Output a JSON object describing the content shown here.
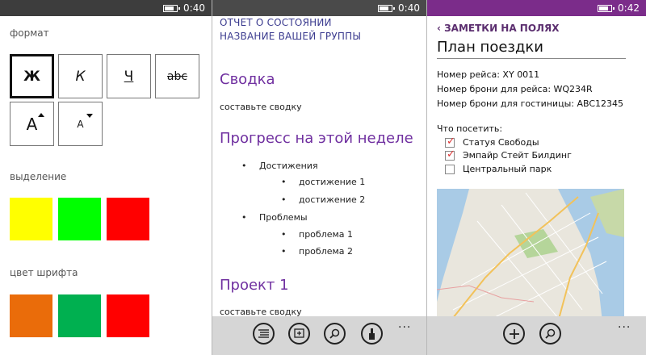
{
  "status": {
    "time1": "0:40",
    "time2": "0:40",
    "time3": "0:42"
  },
  "format_panel": {
    "format_label": "формат",
    "buttons": {
      "bold": "Ж",
      "italic": "К",
      "underline": "Ч",
      "strike": "abc",
      "grow": "A",
      "shrink": "A"
    },
    "highlight_label": "выделение",
    "highlight_colors": [
      "#ffff00",
      "#00ff00",
      "#ff0000"
    ],
    "fontcolor_label": "цвет шрифта",
    "font_colors": [
      "#ea6c0a",
      "#00b050",
      "#ff0000"
    ]
  },
  "report": {
    "header_line1": "ОТЧЕТ О СОСТОЯНИИ",
    "header_line2": "НАЗВАНИЕ ВАШЕЙ ГРУППЫ",
    "summary_heading": "Сводка",
    "summary_text": "составьте сводку",
    "progress_heading": "Прогресс на этой неделе",
    "bullets": [
      {
        "label": "Достижения",
        "children": [
          "достижение 1",
          "достижение 2"
        ]
      },
      {
        "label": "Проблемы",
        "children": [
          "проблема 1",
          "проблема 2"
        ]
      }
    ],
    "project_heading": "Проект 1",
    "project_text": "составьте сводку",
    "appbar_icons": [
      "list-icon",
      "add-note-icon",
      "search-icon",
      "brush-icon"
    ],
    "more": "..."
  },
  "trip": {
    "back_label": "ЗАМЕТКИ НА ПОЛЯХ",
    "title": "План поездки",
    "flight": "Номер рейса: XY 0011",
    "flight_booking": "Номер брони для рейса: WQ234R",
    "hotel_booking": "Номер брони для гостиницы: ABC12345",
    "visit_label": "Что посетить:",
    "checklist": [
      {
        "label": "Статуя Свободы",
        "checked": true
      },
      {
        "label": "Эмпайр Стейт Билдинг",
        "checked": true
      },
      {
        "label": "Центральный парк",
        "checked": false
      }
    ],
    "appbar_icons": [
      "add-icon",
      "search-icon"
    ],
    "more": "..."
  },
  "colors": {
    "status1": "#3d3d3d",
    "status2": "#4a4a4a",
    "status3": "#7b2c8a",
    "accent_purple": "#7030a0"
  }
}
